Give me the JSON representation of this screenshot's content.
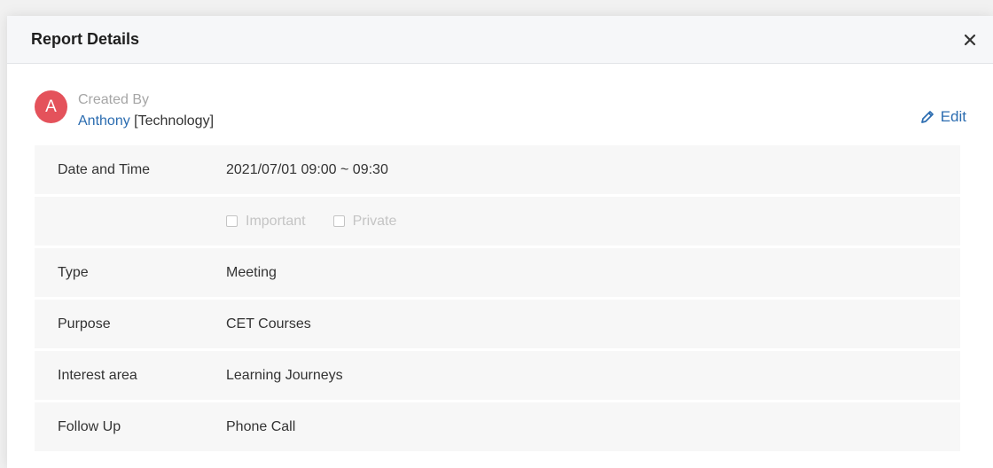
{
  "modal": {
    "title": "Report Details",
    "close_icon": "close-icon"
  },
  "creator": {
    "avatar_letter": "A",
    "avatar_color": "#e4525b",
    "created_by_label": "Created By",
    "name": "Anthony",
    "department": "[Technology]"
  },
  "edit": {
    "label": "Edit",
    "icon": "pencil-icon"
  },
  "details": {
    "date_time": {
      "label": "Date and Time",
      "value": "2021/07/01 09:00 ~ 09:30"
    },
    "flags": {
      "important_label": "Important",
      "private_label": "Private",
      "important_checked": false,
      "private_checked": false
    },
    "type": {
      "label": "Type",
      "value": "Meeting"
    },
    "purpose": {
      "label": "Purpose",
      "value": "CET Courses"
    },
    "interest_area": {
      "label": "Interest area",
      "value": "Learning Journeys"
    },
    "follow_up": {
      "label": "Follow Up",
      "value": "Phone Call"
    }
  },
  "colors": {
    "link": "#2b6cb0",
    "row_background": "#f7f7f7"
  }
}
